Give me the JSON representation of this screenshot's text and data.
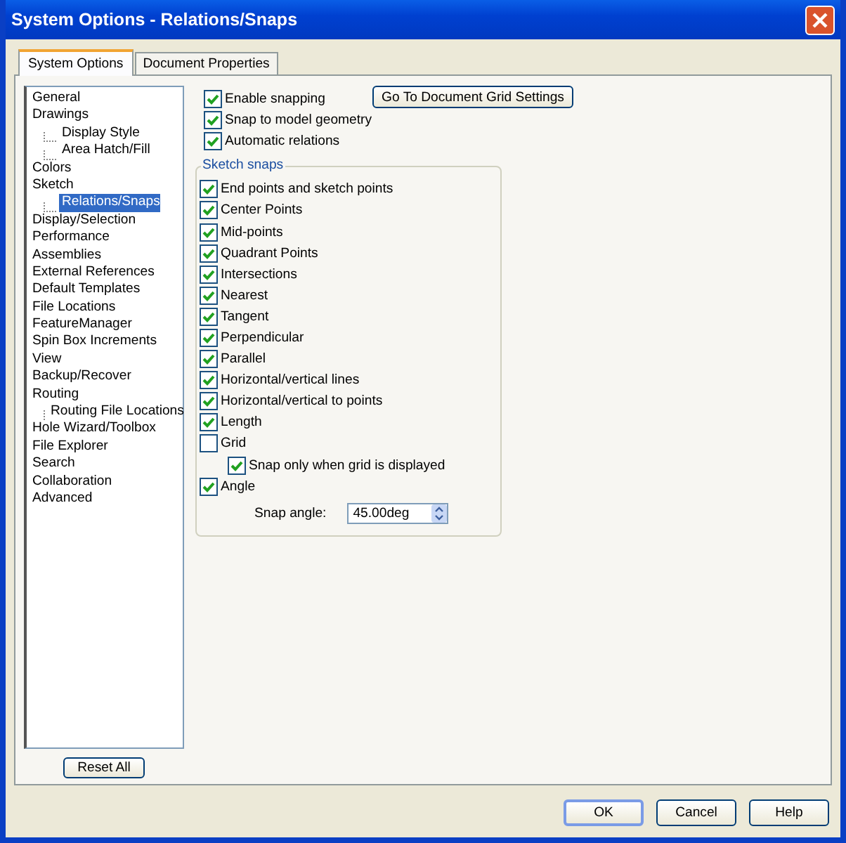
{
  "window": {
    "title": "System Options - Relations/Snaps"
  },
  "tabs": [
    {
      "label": "System Options",
      "selected": true
    },
    {
      "label": "Document Properties",
      "selected": false
    }
  ],
  "tree": [
    {
      "label": "General",
      "selected": false
    },
    {
      "label": "Drawings",
      "selected": false,
      "children": [
        {
          "label": "Display Style",
          "selected": false
        },
        {
          "label": "Area Hatch/Fill",
          "selected": false
        }
      ]
    },
    {
      "label": "Colors",
      "selected": false
    },
    {
      "label": "Sketch",
      "selected": false,
      "children": [
        {
          "label": "Relations/Snaps",
          "selected": true
        }
      ]
    },
    {
      "label": "Display/Selection",
      "selected": false
    },
    {
      "label": "Performance",
      "selected": false
    },
    {
      "label": "Assemblies",
      "selected": false
    },
    {
      "label": "External References",
      "selected": false
    },
    {
      "label": "Default Templates",
      "selected": false
    },
    {
      "label": "File Locations",
      "selected": false
    },
    {
      "label": "FeatureManager",
      "selected": false
    },
    {
      "label": "Spin Box Increments",
      "selected": false
    },
    {
      "label": "View",
      "selected": false
    },
    {
      "label": "Backup/Recover",
      "selected": false
    },
    {
      "label": "Routing",
      "selected": false,
      "children": [
        {
          "label": "Routing File Locations",
          "selected": false
        }
      ]
    },
    {
      "label": "Hole Wizard/Toolbox",
      "selected": false
    },
    {
      "label": "File Explorer",
      "selected": false
    },
    {
      "label": "Search",
      "selected": false
    },
    {
      "label": "Collaboration",
      "selected": false
    },
    {
      "label": "Advanced",
      "selected": false
    }
  ],
  "reset_button": "Reset All",
  "grid_button": "Go To Document Grid Settings",
  "options": [
    {
      "kind": "checkbox",
      "label": "Enable snapping",
      "checked": true
    },
    {
      "kind": "checkbox",
      "label": "Snap to model geometry",
      "checked": true
    },
    {
      "kind": "checkbox",
      "label": "Automatic relations",
      "checked": true
    }
  ],
  "sketch_snaps": {
    "title": "Sketch snaps",
    "items": [
      {
        "kind": "checkbox",
        "label": "End points and sketch points",
        "checked": true
      },
      {
        "kind": "checkbox",
        "label": "Center Points",
        "checked": true
      },
      {
        "kind": "checkbox",
        "label": "Mid-points",
        "checked": true
      },
      {
        "kind": "checkbox",
        "label": "Quadrant Points",
        "checked": true
      },
      {
        "kind": "checkbox",
        "label": "Intersections",
        "checked": true
      },
      {
        "kind": "checkbox",
        "label": "Nearest",
        "checked": true
      },
      {
        "kind": "checkbox",
        "label": "Tangent",
        "checked": true
      },
      {
        "kind": "checkbox",
        "label": "Perpendicular",
        "checked": true
      },
      {
        "kind": "checkbox",
        "label": "Parallel",
        "checked": true
      },
      {
        "kind": "checkbox",
        "label": "Horizontal/vertical lines",
        "checked": true
      },
      {
        "kind": "checkbox",
        "label": "Horizontal/vertical to points",
        "checked": true
      },
      {
        "kind": "checkbox",
        "label": "Length",
        "checked": true
      },
      {
        "kind": "checkbox",
        "label": "Grid",
        "checked": false,
        "children": [
          {
            "kind": "checkbox",
            "label": "Snap only when grid is displayed",
            "checked": true
          }
        ]
      },
      {
        "kind": "checkbox",
        "label": "Angle",
        "checked": true,
        "children": [
          {
            "kind": "spin",
            "label": "Snap angle:",
            "value": "45.00deg"
          }
        ]
      }
    ]
  },
  "buttons": [
    "OK",
    "Cancel",
    "Help"
  ]
}
